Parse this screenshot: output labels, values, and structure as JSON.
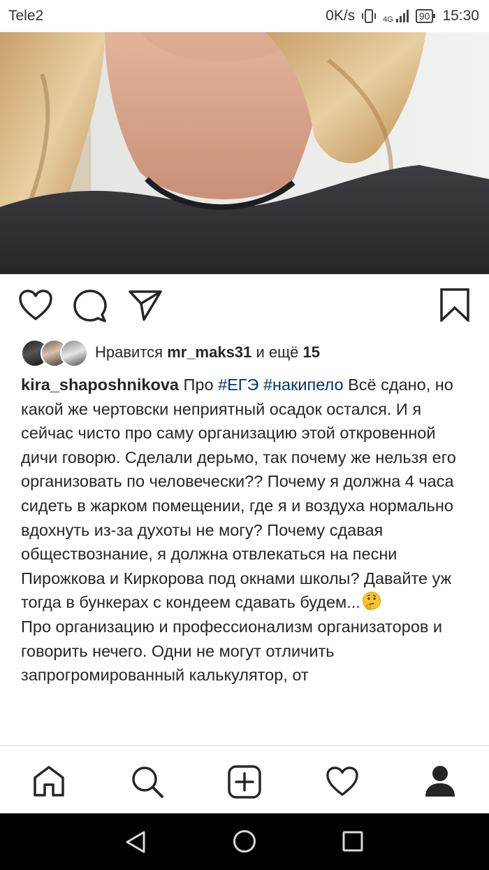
{
  "status_bar": {
    "carrier": "Tele2",
    "speed": "0K/s",
    "network": "4G",
    "battery": "90",
    "time": "15:30"
  },
  "post": {
    "likes": {
      "prefix": "Нравится",
      "user": "mr_maks31",
      "middle": "и ещё",
      "count": "15"
    },
    "caption": {
      "username": "kira_shaposhnikova",
      "intro": "Про",
      "hashtags": [
        "#ЕГЭ",
        "#накипело"
      ],
      "paragraph1": "Всё сдано, но какой же чертовски неприятный осадок остался. И я сейчас чисто про саму организацию этой откровенной дичи говорю. Сделали дерьмо, так почему же нельзя его организовать по человечески?? Почему я должна 4 часа сидеть в жарком помещении, где я и воздуха нормально вдохнуть из-за духоты не могу? Почему сдавая обществознание, я должна отвлекаться на песни Пирожкова и Киркорова под окнами школы? Давайте уж тогда в бункерах с кондеем сдавать будем...",
      "paragraph2": "Про организацию и профессионализм организаторов и говорить нечего. Одни не могут отличить запрогромированный калькулятор, от"
    }
  },
  "icons": {
    "like": "heart-icon",
    "comment": "comment-icon",
    "share": "send-icon",
    "save": "bookmark-icon",
    "emoji": "thinking-face-emoji",
    "nav": [
      "home-icon",
      "search-icon",
      "add-post-icon",
      "activity-heart-icon",
      "profile-icon"
    ],
    "system": [
      "back-icon",
      "home-circle-icon",
      "recents-icon"
    ]
  },
  "colors": {
    "hashtag": "#003569",
    "text": "#262626"
  }
}
